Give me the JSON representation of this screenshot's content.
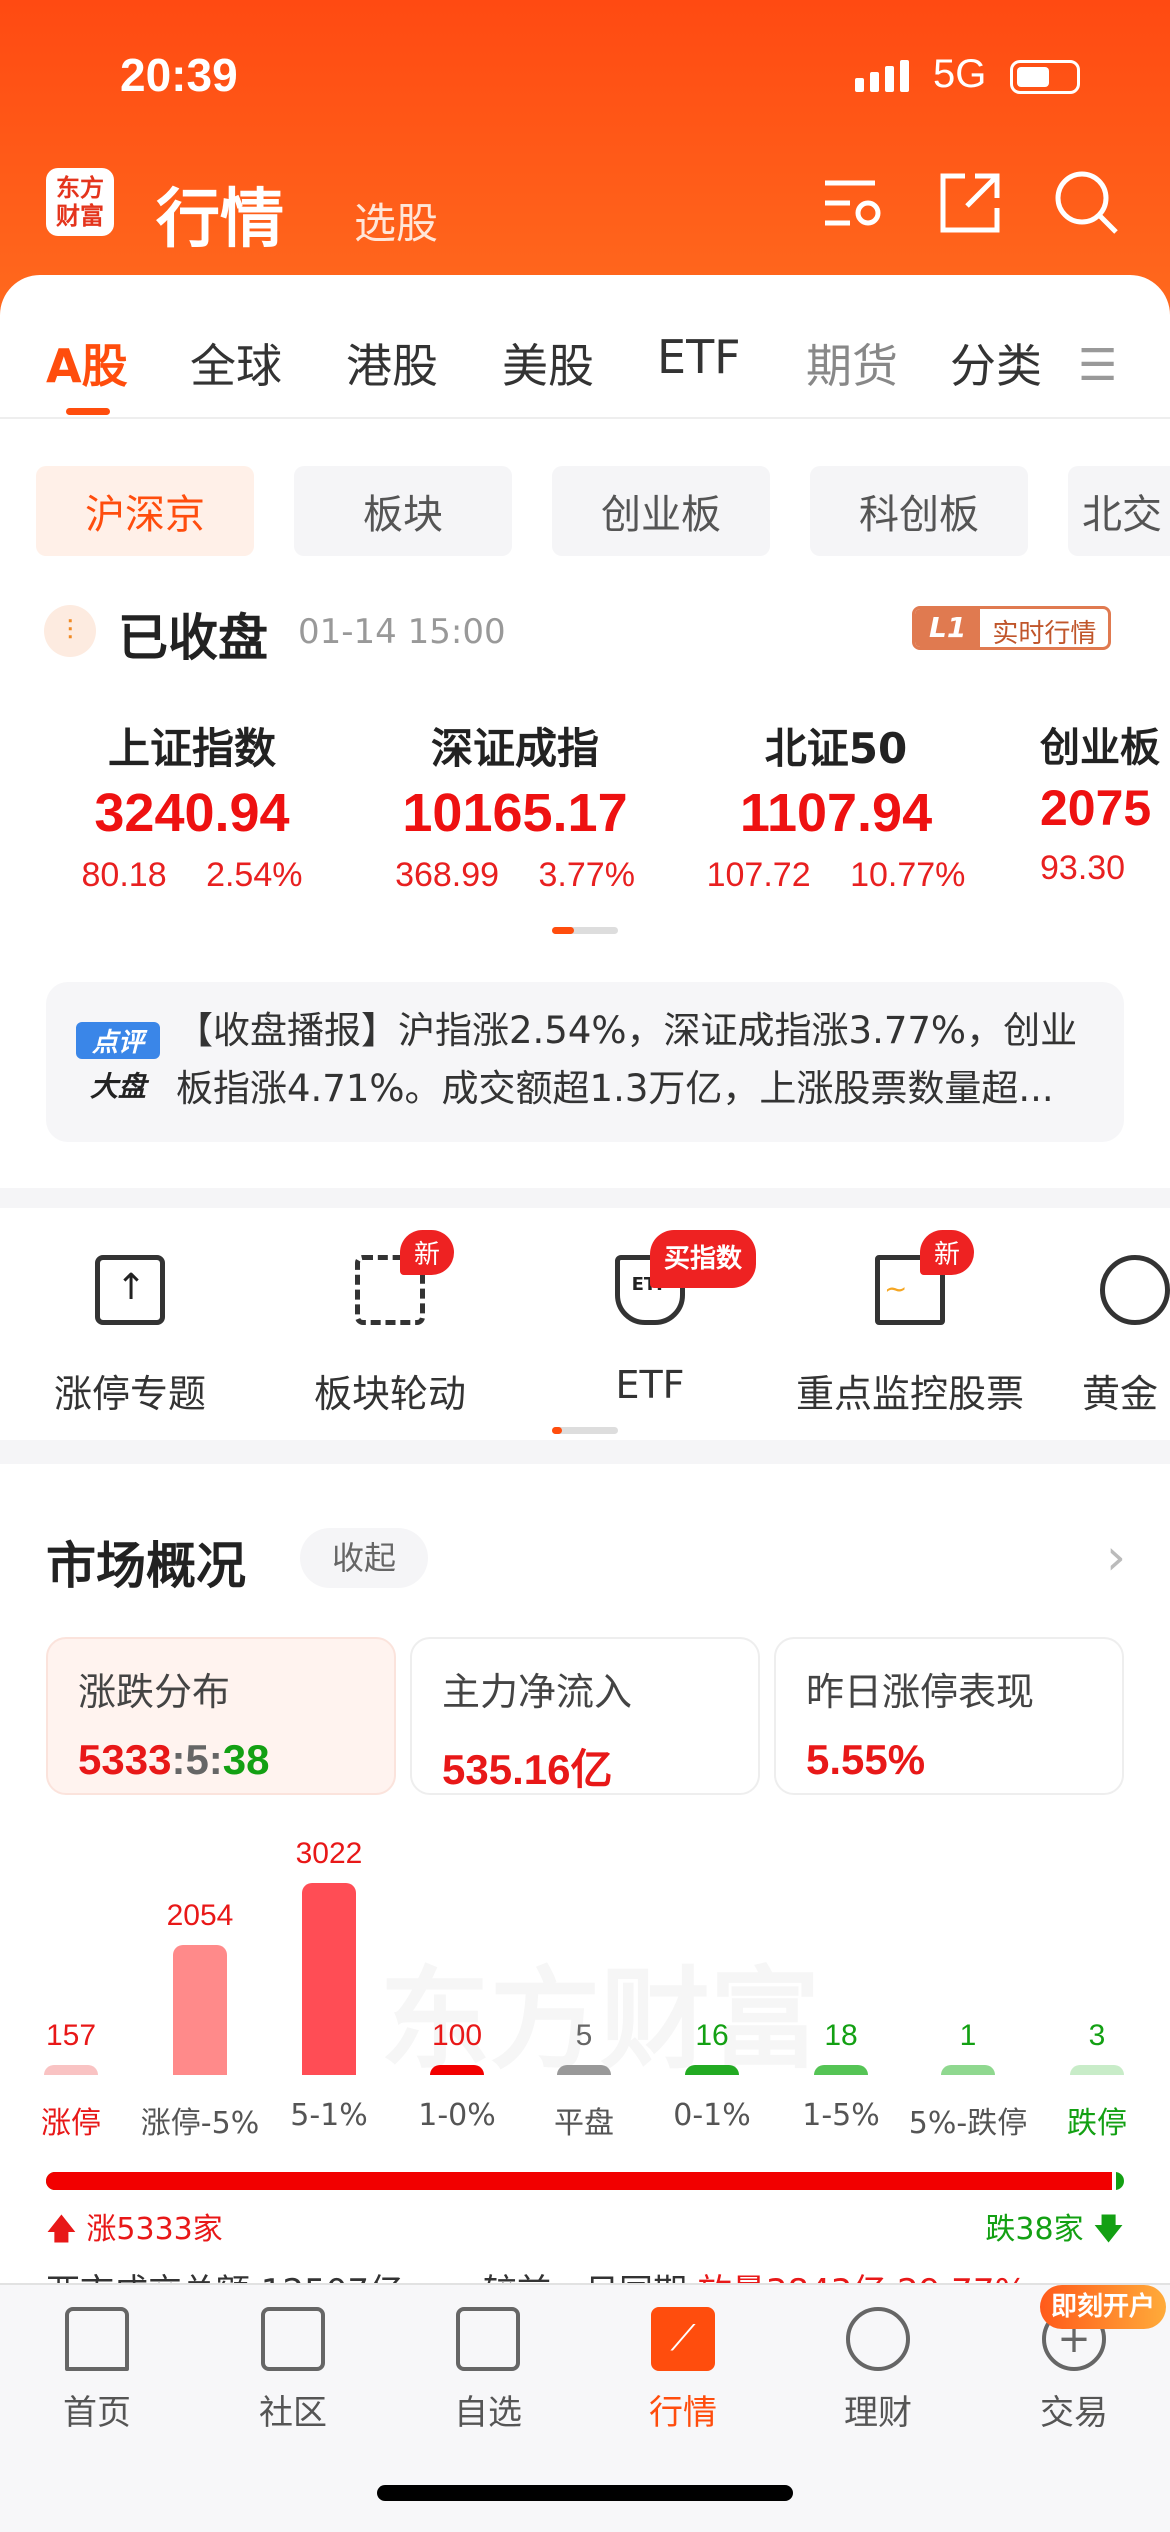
{
  "status": {
    "time": "20:39",
    "network": "5G"
  },
  "header": {
    "logo": "东方财富",
    "title": "行情",
    "subtitle": "选股",
    "icons": [
      "settings-list-icon",
      "share-icon",
      "search-icon"
    ]
  },
  "tabs": [
    {
      "label": "A股",
      "active": true
    },
    {
      "label": "全球"
    },
    {
      "label": "港股"
    },
    {
      "label": "美股"
    },
    {
      "label": "ETF"
    },
    {
      "label": "期货"
    },
    {
      "label": "分类"
    }
  ],
  "chips": [
    {
      "label": "沪深京",
      "active": true
    },
    {
      "label": "板块"
    },
    {
      "label": "创业板"
    },
    {
      "label": "科创板"
    },
    {
      "label": "北交"
    }
  ],
  "market_status": {
    "label": "已收盘",
    "time": "01-14 15:00",
    "badge_l1": "L1",
    "badge_text": "实时行情"
  },
  "indices": [
    {
      "name": "上证指数",
      "value": "3240.94",
      "change": "80.18",
      "pct": "2.54%"
    },
    {
      "name": "深证成指",
      "value": "10165.17",
      "change": "368.99",
      "pct": "3.77%"
    },
    {
      "name": "北证50",
      "value": "1107.94",
      "change": "107.72",
      "pct": "10.77%"
    },
    {
      "name": "创业板",
      "value": "2075",
      "change": "93.30",
      "pct": ""
    }
  ],
  "news": {
    "tag_top": "点评",
    "tag_bottom": "大盘",
    "text": "【收盘播报】沪指涨2.54%，深证成指涨3.77%，创业板指涨4.71%。成交额超1.3万亿，上涨股票数量超..."
  },
  "functions": [
    {
      "label": "涨停专题",
      "icon": "limit-up-icon"
    },
    {
      "label": "板块轮动",
      "icon": "rotation-icon",
      "badge": "新"
    },
    {
      "label": "ETF",
      "icon": "etf-icon",
      "badge": "买指数"
    },
    {
      "label": "重点监控股票",
      "icon": "monitor-icon",
      "badge": "新"
    },
    {
      "label": "黄金",
      "icon": "gold-icon"
    }
  ],
  "overview": {
    "title": "市场概况",
    "collapse": "收起",
    "cards": [
      {
        "title": "涨跌分布",
        "up": "5333",
        "flat": "5",
        "down": "38"
      },
      {
        "title": "主力净流入",
        "value": "535.16亿"
      },
      {
        "title": "昨日涨停表现",
        "value": "5.55%"
      }
    ],
    "up_label": "涨5333家",
    "down_label": "跌38家",
    "turnover_partial": "两市成交总额 12507亿",
    "compare_partial": "较前一日同期",
    "compare_value_partial": "放量3843亿 29.77%",
    "watermark": "东方财富"
  },
  "chart_data": {
    "type": "bar",
    "categories": [
      "涨停",
      "涨停-5%",
      "5-1%",
      "1-0%",
      "平盘",
      "0-1%",
      "1-5%",
      "5%-跌停",
      "跌停"
    ],
    "values": [
      157,
      2054,
      3022,
      100,
      5,
      16,
      18,
      1,
      3
    ],
    "colors": [
      "#f9c3c3",
      "#ff8a8a",
      "#ff4d55",
      "#f20000",
      "#999999",
      "#22aa22",
      "#55c455",
      "#8fd88f",
      "#c8ecc8"
    ],
    "label_colors": [
      "#e81818",
      "#e81818",
      "#e81818",
      "#e81818",
      "#666666",
      "#13a013",
      "#13a013",
      "#13a013",
      "#13a013"
    ],
    "up_share": 0.993
  },
  "bottom_nav": [
    {
      "label": "首页",
      "icon": "home-icon"
    },
    {
      "label": "社区",
      "icon": "community-icon"
    },
    {
      "label": "自选",
      "icon": "watchlist-icon"
    },
    {
      "label": "行情",
      "icon": "market-icon",
      "active": true
    },
    {
      "label": "理财",
      "icon": "wealth-icon"
    },
    {
      "label": "交易",
      "icon": "trade-icon"
    }
  ],
  "open_account": "即刻开户",
  "colors": {
    "brand": "#ff4d0d",
    "up": "#e81818",
    "down": "#13a013"
  }
}
